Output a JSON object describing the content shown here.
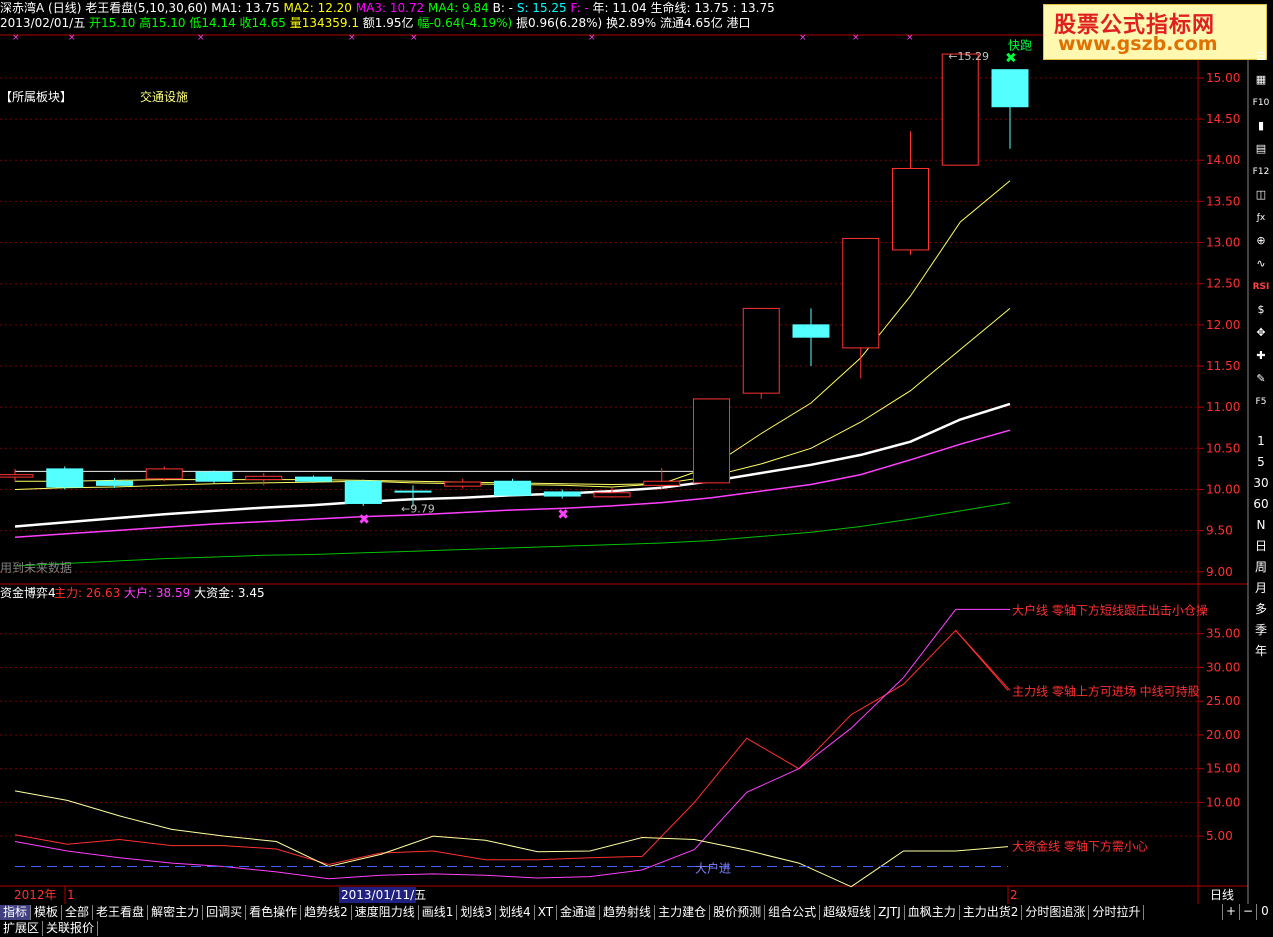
{
  "header": {
    "line1": [
      {
        "text": "深赤湾A",
        "color": "#ffffff"
      },
      {
        "text": "(日线)",
        "color": "#ffffff"
      },
      {
        "text": "老王看盘(5,10,30,60)",
        "color": "#ffffff"
      },
      {
        "text": "MA1: 13.75",
        "color": "#ffffff"
      },
      {
        "text": "MA2: 12.20",
        "color": "#ffff00"
      },
      {
        "text": "MA3: 10.72",
        "color": "#ff00ff"
      },
      {
        "text": "MA4: 9.84",
        "color": "#00ff00"
      },
      {
        "text": "B: -",
        "color": "#ffffff"
      },
      {
        "text": "S: 15.25",
        "color": "#00ffff"
      },
      {
        "text": "F: -",
        "color": "#ff00ff"
      },
      {
        "text": "年: 11.04",
        "color": "#ffffff"
      },
      {
        "text": "生命线: 13.75",
        "color": "#ffffff"
      },
      {
        "text": ": 13.75",
        "color": "#ffffff"
      }
    ],
    "line2": [
      {
        "text": "2013/02/01/五",
        "color": "#ffffff"
      },
      {
        "text": "开15.10",
        "color": "#00ff00"
      },
      {
        "text": "高15.10",
        "color": "#00ff00"
      },
      {
        "text": "低14.14",
        "color": "#00ff00"
      },
      {
        "text": "收14.65",
        "color": "#00ff00"
      },
      {
        "text": "量134359.1",
        "color": "#ffff00"
      },
      {
        "text": "额1.95亿",
        "color": "#ffffff"
      },
      {
        "text": "幅-0.64(-4.19%)",
        "color": "#00ff00"
      },
      {
        "text": "振0.96(6.28%)",
        "color": "#ffffff"
      },
      {
        "text": "换2.89%",
        "color": "#ffffff"
      },
      {
        "text": "流通4.65亿",
        "color": "#ffffff"
      },
      {
        "text": "港口",
        "color": "#ffffff"
      }
    ]
  },
  "watermark": {
    "line1": "股票公式指标网",
    "line2": "www.gszb.com"
  },
  "sector": {
    "label": "【所属板块】",
    "value": "交通设施"
  },
  "future_note": "用到未来数据",
  "colors": {
    "up": "#ff3232",
    "down": "#54ffff",
    "ma1": "#ffffff",
    "ma2": "#ffff60",
    "ma3": "#ff40ff",
    "ma4": "#00c000",
    "axis": "#b00000",
    "grid": "#7a0000"
  },
  "chart_data": [
    {
      "type": "candlestick",
      "title": "深赤湾A (日线)",
      "ylim": [
        8.9,
        15.4
      ],
      "yticks": [
        "15.00",
        "14.50",
        "14.00",
        "13.50",
        "13.00",
        "12.50",
        "12.00",
        "11.50",
        "11.00",
        "10.50",
        "10.00",
        "9.50",
        "9.00"
      ],
      "candles": [
        {
          "o": 10.15,
          "c": 10.18,
          "h": 10.25,
          "l": 10.1
        },
        {
          "o": 10.25,
          "c": 10.03,
          "h": 10.28,
          "l": 10.0
        },
        {
          "o": 10.1,
          "c": 10.05,
          "h": 10.14,
          "l": 10.02
        },
        {
          "o": 10.13,
          "c": 10.25,
          "h": 10.28,
          "l": 10.1
        },
        {
          "o": 10.21,
          "c": 10.1,
          "h": 10.23,
          "l": 10.07
        },
        {
          "o": 10.12,
          "c": 10.16,
          "h": 10.2,
          "l": 10.05
        },
        {
          "o": 10.15,
          "c": 10.1,
          "h": 10.17,
          "l": 10.08
        },
        {
          "o": 10.1,
          "c": 9.83,
          "h": 10.12,
          "l": 9.8
        },
        {
          "o": 9.98,
          "c": 9.97,
          "h": 10.05,
          "l": 9.79
        },
        {
          "o": 10.04,
          "c": 10.09,
          "h": 10.13,
          "l": 10.01
        },
        {
          "o": 10.1,
          "c": 9.93,
          "h": 10.13,
          "l": 9.92
        },
        {
          "o": 9.97,
          "c": 9.92,
          "h": 10.0,
          "l": 9.89
        },
        {
          "o": 9.91,
          "c": 9.96,
          "h": 10.02,
          "l": 9.9
        },
        {
          "o": 10.05,
          "c": 10.1,
          "h": 10.26,
          "l": 10.0
        },
        {
          "o": 10.08,
          "c": 11.1,
          "h": 11.1,
          "l": 10.08
        },
        {
          "o": 11.17,
          "c": 12.2,
          "h": 12.2,
          "l": 11.1
        },
        {
          "o": 12.0,
          "c": 11.85,
          "h": 12.2,
          "l": 11.5
        },
        {
          "o": 11.72,
          "c": 13.05,
          "h": 13.05,
          "l": 11.35
        },
        {
          "o": 12.91,
          "c": 13.9,
          "h": 14.35,
          "l": 12.85
        },
        {
          "o": 13.94,
          "c": 15.29,
          "h": 15.29,
          "l": 13.94
        },
        {
          "o": 15.1,
          "c": 14.65,
          "h": 15.1,
          "l": 14.14
        }
      ],
      "series": [
        {
          "name": "MA1",
          "values": [
            10.0,
            10.02,
            10.03,
            10.05,
            10.07,
            10.08,
            10.09,
            10.1,
            10.08,
            10.07,
            10.06,
            10.05,
            10.03,
            10.07,
            10.28,
            10.68,
            11.05,
            11.6,
            12.35,
            13.25,
            13.75
          ]
        },
        {
          "name": "MA2",
          "values": [
            10.1,
            10.1,
            10.11,
            10.12,
            10.12,
            10.12,
            10.12,
            10.11,
            10.1,
            10.09,
            10.08,
            10.07,
            10.06,
            10.07,
            10.16,
            10.31,
            10.5,
            10.82,
            11.2,
            11.7,
            12.2
          ]
        },
        {
          "name": "MA3",
          "values": [
            9.42,
            9.46,
            9.5,
            9.54,
            9.58,
            9.61,
            9.64,
            9.67,
            9.69,
            9.72,
            9.75,
            9.77,
            9.8,
            9.84,
            9.9,
            9.98,
            10.06,
            10.18,
            10.36,
            10.55,
            10.72
          ]
        },
        {
          "name": "MA4",
          "values": [
            9.07,
            9.1,
            9.13,
            9.16,
            9.18,
            9.2,
            9.21,
            9.23,
            9.25,
            9.27,
            9.29,
            9.31,
            9.33,
            9.35,
            9.38,
            9.43,
            9.48,
            9.55,
            9.64,
            9.74,
            9.84
          ]
        },
        {
          "name": "生命线",
          "values": [
            9.55,
            9.6,
            9.65,
            9.7,
            9.74,
            9.78,
            9.81,
            9.85,
            9.88,
            9.9,
            9.93,
            9.95,
            9.98,
            10.02,
            10.1,
            10.2,
            10.3,
            10.42,
            10.58,
            10.85,
            11.04
          ]
        },
        {
          "name": "S",
          "values": [
            10.22,
            10.22,
            10.22,
            10.22,
            10.22,
            10.22,
            10.22,
            10.22,
            10.22,
            10.22,
            10.22,
            10.22,
            10.22,
            10.22,
            10.22
          ]
        }
      ],
      "markers": [
        {
          "label": "",
          "index": 7,
          "value": 9.64,
          "kind": "x"
        },
        {
          "label": "",
          "index": 11,
          "value": 9.7,
          "kind": "x"
        },
        {
          "label": "快跑",
          "index": 20,
          "value": 15.25,
          "kind": "x"
        }
      ],
      "annotations": [
        {
          "text": "9.79",
          "index": 8,
          "value": 9.79
        },
        {
          "text": "15.29",
          "index": 19,
          "value": 15.29
        }
      ]
    },
    {
      "type": "line",
      "title": "资金博弈4",
      "legend": [
        {
          "text": "主力: 26.63",
          "color": "#ff3030"
        },
        {
          "text": "大户: 38.59",
          "color": "#ff40ff"
        },
        {
          "text": "大资金: 3.45",
          "color": "#ffffff"
        }
      ],
      "ylim": [
        -1.5,
        40
      ],
      "yticks": [
        "35.00",
        "30.00",
        "25.00",
        "20.00",
        "15.00",
        "10.00",
        "5.00"
      ],
      "series": [
        {
          "name": "主力",
          "color": "#ff3030",
          "values": [
            5.2,
            3.8,
            4.5,
            3.6,
            3.6,
            3.1,
            0.8,
            2.5,
            2.8,
            1.5,
            1.5,
            1.8,
            2.0,
            10.0,
            19.5,
            15.0,
            23.0,
            27.5,
            35.5,
            26.6
          ]
        },
        {
          "name": "大户",
          "color": "#ff40ff",
          "values": [
            4.2,
            2.8,
            1.8,
            1.0,
            0.5,
            -0.3,
            -1.3,
            -0.8,
            -0.6,
            -0.8,
            -1.2,
            -1.0,
            0.0,
            3.0,
            11.5,
            15.0,
            21.0,
            28.5,
            38.6,
            38.6
          ]
        },
        {
          "name": "大资金",
          "color": "#ffffa0",
          "values": [
            11.7,
            10.3,
            8.0,
            6.0,
            5.0,
            4.2,
            0.5,
            2.3,
            5.0,
            4.4,
            2.7,
            2.8,
            4.8,
            4.5,
            2.9,
            1.0,
            -2.5,
            2.8,
            2.8,
            3.45
          ]
        },
        {
          "name": "零轴",
          "color": "#4060ff",
          "values": [
            0.5,
            0.5,
            0.5,
            0.5,
            0.5,
            0.5,
            0.5,
            0.5,
            0.5,
            0.5,
            0.5,
            0.5,
            0.5,
            0.5,
            0.5,
            0.5,
            0.5,
            0.5,
            0.5,
            0.5
          ]
        }
      ],
      "annotations": [
        {
          "text": "大户进",
          "color": "#8080ff"
        },
        {
          "text": "大户线 零轴下方短线跟庄出击小仓操",
          "color": "#ff3030"
        },
        {
          "text": "主力线 零轴上方可进场 中线可持股",
          "color": "#ff3030"
        },
        {
          "text": "大资金线 零轴下方需小心",
          "color": "#ff3030"
        }
      ]
    }
  ],
  "time_axis": {
    "year_label": "2012年",
    "left_tick": "1",
    "cursor_date": "2013/01/11/五",
    "right_tick": "2",
    "period": "日线"
  },
  "right_toolbar": {
    "icons": [
      "list-icon",
      "table-icon",
      "f10-icon",
      "bar-icon",
      "document-icon",
      "f12-icon",
      "chart-icon",
      "fx-icon",
      "zoom-icon",
      "wave-icon",
      "rsi-icon",
      "dollar-icon",
      "move-icon",
      "plus-icon",
      "pen-icon",
      "f5-icon"
    ],
    "labels": {
      "f10": "F10",
      "f12": "F12",
      "rsi": "RSI",
      "f5": "F5"
    },
    "periods": [
      "1",
      "5",
      "30",
      "60",
      "N",
      "日",
      "周",
      "月",
      "多",
      "季",
      "年"
    ]
  },
  "tabs": [
    "指标",
    "模板",
    "全部",
    "老王看盘",
    "解密主力",
    "回调买",
    "看色操作",
    "趋势线2",
    "速度阻力线",
    "画线1",
    "划线3",
    "划线4",
    "XT",
    "金通道",
    "趋势射线",
    "主力建仓",
    "股价预测",
    "组合公式",
    "超级短线",
    "ZJTJ",
    "血枫主力",
    "主力出货2",
    "分时图追涨",
    "分时拉升"
  ],
  "status": [
    "扩展区",
    "关联报价"
  ],
  "zoom": [
    "+",
    "−",
    "0"
  ]
}
